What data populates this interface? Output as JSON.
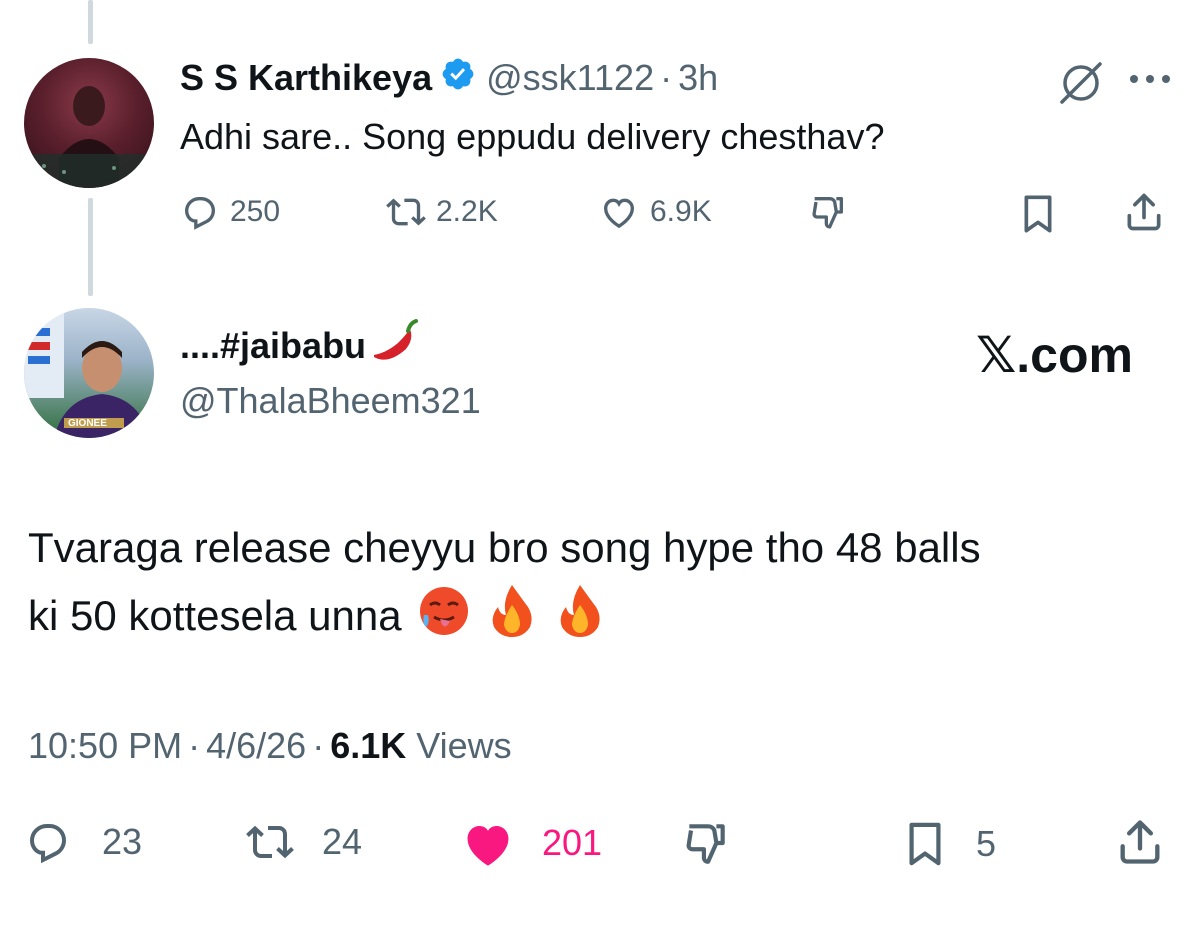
{
  "parent_tweet": {
    "avatar_icon": "user-avatar-karthikeya",
    "display_name": "S S Karthikeya",
    "verified_icon": "verified-badge-icon",
    "handle": "@ssk1122",
    "separator": "·",
    "time": "3h",
    "grok_icon": "grok-icon",
    "more_icon": "more-icon",
    "text": "Adhi sare.. Song eppudu delivery chesthav?",
    "actions": {
      "replies": "250",
      "reposts": "2.2K",
      "likes": "6.9K"
    }
  },
  "reply_tweet": {
    "avatar_icon": "user-avatar-thalabheem",
    "display_name": "....#jaibabu",
    "name_emoji_icon": "chili-pepper-icon",
    "handle": "@ThalaBheem321",
    "watermark": "𝕏.com",
    "text_line1": "Tvaraga release cheyyu bro song hype tho 48 balls",
    "text_line2": "ki 50 kottesela unna",
    "emojis": [
      "hot-face-icon",
      "fire-icon",
      "fire-icon"
    ],
    "meta": {
      "time": "10:50 PM",
      "sep1": "·",
      "date": "4/6/26",
      "sep2": "·",
      "views_count": "6.1K",
      "views_label": "Views"
    },
    "actions": {
      "replies": "23",
      "reposts": "24",
      "likes": "201",
      "bookmarks": "5"
    }
  },
  "colors": {
    "text": "#0f1419",
    "secondary": "#536471",
    "verified": "#1d9bf0",
    "liked": "#f91880",
    "thread_line": "#cfd9de"
  }
}
